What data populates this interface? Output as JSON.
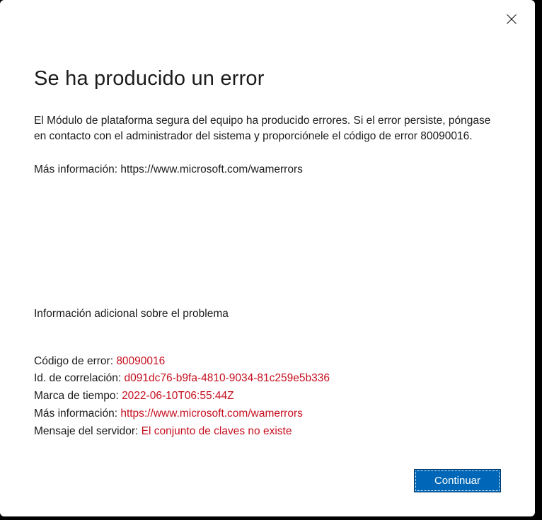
{
  "dialog": {
    "title": "Se ha producido un error",
    "description": "El Módulo de plataforma segura del equipo ha producido errores. Si el error persiste, póngase en contacto con el administrador del sistema y proporciónele el código de error 80090016.",
    "more_info_prefix": "Más información: ",
    "more_info_url": "https://www.microsoft.com/wamerrors"
  },
  "additional": {
    "title": "Información adicional sobre el problema",
    "error_code_label": "Código de error: ",
    "error_code_value": "80090016",
    "correlation_label": "Id. de correlación: ",
    "correlation_value": "d091dc76-b9fa-4810-9034-81c259e5b336",
    "timestamp_label": "Marca de tiempo: ",
    "timestamp_value": "2022-06-10T06:55:44Z",
    "more_info_label": "Más información: ",
    "more_info_value": "https://www.microsoft.com/wamerrors",
    "server_msg_label": "Mensaje del servidor: ",
    "server_msg_value": "El conjunto de claves no existe"
  },
  "buttons": {
    "continue": "Continuar"
  }
}
